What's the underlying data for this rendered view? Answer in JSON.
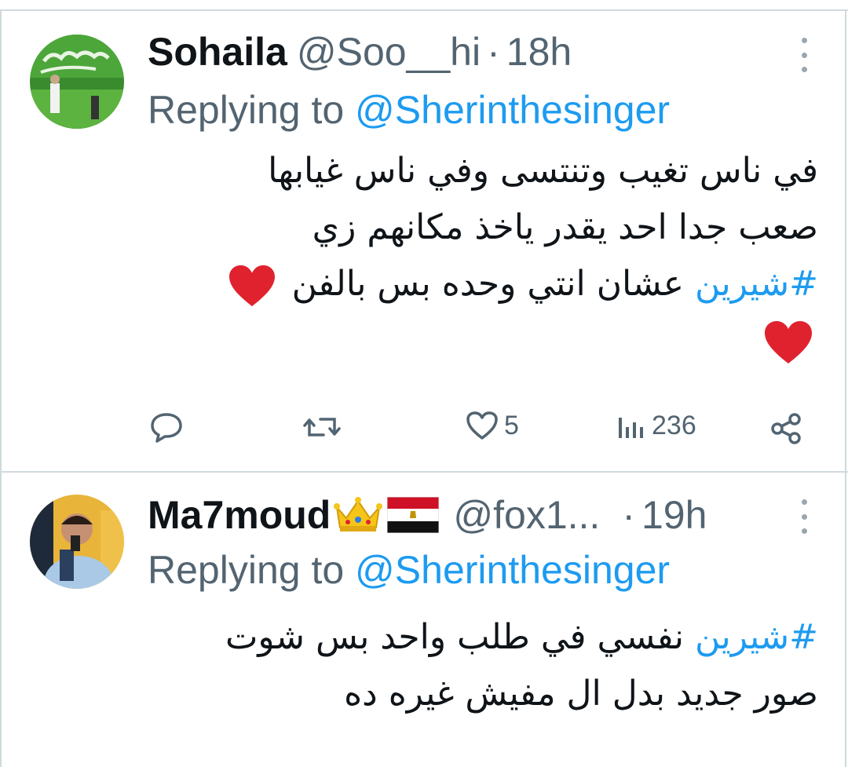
{
  "tweets": [
    {
      "name": "Sohaila",
      "handle": "@Soo__hi",
      "separator": "·",
      "time": "18h",
      "replying_prefix": "Replying to ",
      "replying_to": "@Sherinthesinger",
      "lines": [
        "في ناس تغيب وتنتسى وفي ناس غيابها",
        "صعب جدا احد يقدر ياخذ مكانهم زي",
        "عشان انتي وحده بس بالفن"
      ],
      "hashtag": "#شيرين",
      "actions": {
        "reply_count": "",
        "retweet_count": "",
        "like_count": "5",
        "views_count": "236"
      }
    },
    {
      "name": "Ma7moud",
      "handle": "@fox1...",
      "separator": "·",
      "time": "19h",
      "replying_prefix": "Replying to ",
      "replying_to": "@Sherinthesinger",
      "lines": [
        "نفسي في طلب واحد بس  شوت",
        "صور جديد بدل  ال مفيش غيره ده"
      ],
      "hashtag": "#شيرين"
    }
  ],
  "icons": {
    "more": "more-vertical-icon",
    "reply": "reply-icon",
    "retweet": "retweet-icon",
    "like": "heart-outline-icon",
    "views": "views-bar-chart-icon",
    "share": "share-icon",
    "heart_emoji": "red-heart-emoji",
    "crown_emoji": "crown-emoji",
    "flag_emoji": "egypt-flag-emoji"
  },
  "colors": {
    "link": "#1d9bf0",
    "secondary_text": "#536471",
    "primary_text": "#0f1419",
    "divider": "#cfd9de",
    "heart_red": "#e0222f"
  }
}
